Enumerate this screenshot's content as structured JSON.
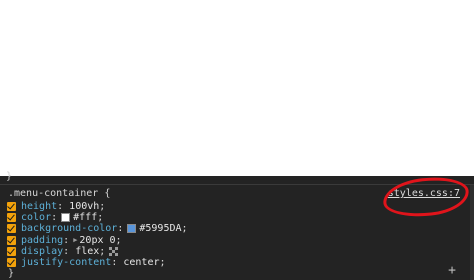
{
  "styles_pane": {
    "previous_rule_close": "}",
    "rule": {
      "selector": ".menu-container",
      "open_brace": " {",
      "close_brace": "}",
      "source": "styles.css:7",
      "declarations": [
        {
          "property": "height",
          "value": "100vh",
          "swatch": null,
          "extra": null
        },
        {
          "property": "color",
          "value": "#fff",
          "swatch": "#ffffff",
          "extra": null
        },
        {
          "property": "background-color",
          "value": "#5995DA",
          "swatch": "#5995DA",
          "extra": null
        },
        {
          "property": "padding",
          "value": "20px 0",
          "swatch": null,
          "extra": "expand-triangle"
        },
        {
          "property": "display",
          "value": "flex",
          "swatch": null,
          "extra": "flex-editor-icon"
        },
        {
          "property": "justify-content",
          "value": "center",
          "swatch": null,
          "extra": null
        }
      ]
    },
    "add_label": "+"
  },
  "colors": {
    "panel_bg": "#232323",
    "property": "#5db0d7",
    "checkbox": "#f3a20b",
    "annotation": "#e0141b"
  },
  "icons": {
    "checkbox": "checkbox-checked-icon",
    "expand": "expand-triangle-icon",
    "flex": "flexbox-editor-icon",
    "add": "plus-icon"
  }
}
